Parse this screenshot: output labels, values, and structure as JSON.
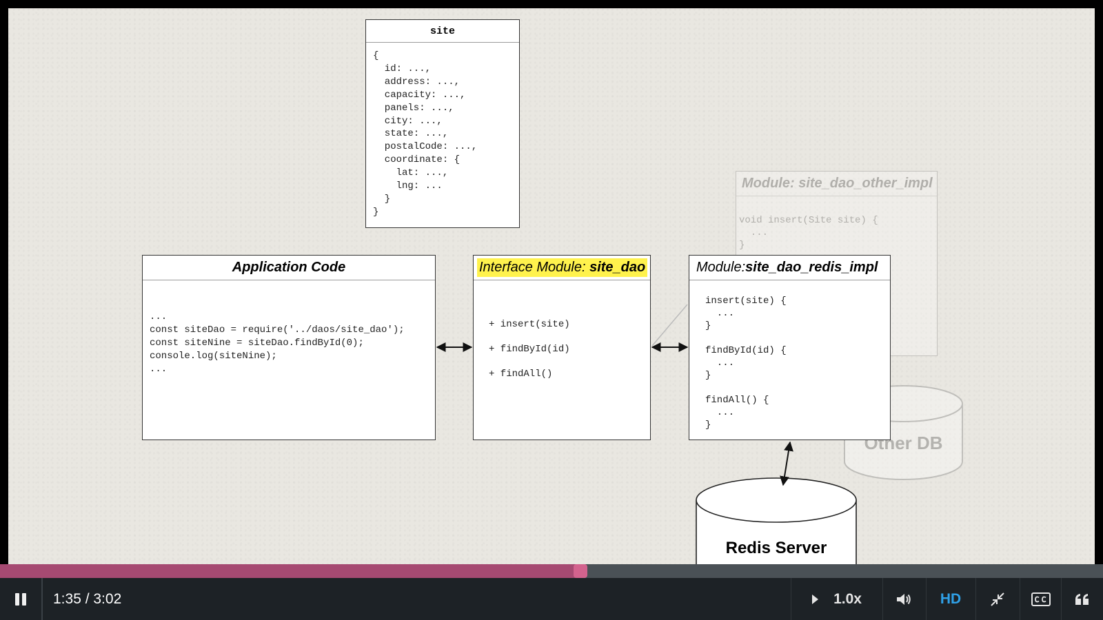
{
  "diagram": {
    "site": {
      "title": "site",
      "body": "{\n  id: ...,\n  address: ...,\n  capacity: ...,\n  panels: ...,\n  city: ...,\n  state: ...,\n  postalCode: ...,\n  coordinate: {\n    lat: ...,\n    lng: ...\n  }\n}"
    },
    "app_code": {
      "title": "Application Code",
      "body": "...\nconst siteDao = require('../daos/site_dao');\nconst siteNine = siteDao.findById(0);\nconsole.log(siteNine);\n..."
    },
    "interface": {
      "title_prefix": "Interface Module: ",
      "title_name": "site_dao",
      "methods": "+ insert(site)\n+ findById(id)\n+ findAll()"
    },
    "redis_impl": {
      "title_prefix": "Module: ",
      "title_name": "site_dao_redis_impl",
      "body": "insert(site) {\n  ...\n}\n\nfindById(id) {\n  ...\n}\n\nfindAll() {\n  ...\n}"
    },
    "other_impl": {
      "title": "Module: site_dao_other_impl",
      "body": "void insert(Site site) {\n  ...\n}"
    },
    "other_db": {
      "label": "Other DB"
    },
    "redis_server": {
      "label": "Redis Server"
    }
  },
  "player": {
    "time": "1:35 / 3:02",
    "progress_fraction": 0.526,
    "speed": "1.0x",
    "quality": "HD",
    "icons": {
      "play_pause": "pause-icon",
      "speed": "play-triangle-icon",
      "volume": "volume-icon",
      "exit_fullscreen": "exit-fullscreen-icon",
      "captions": "closed-captions-icon",
      "transcript": "quote-icon"
    },
    "colors": {
      "progress_fill": "#a64a72",
      "progress_knob": "#d3638e",
      "track": "#4a5156",
      "bar": "#1d2226",
      "hd": "#2fa1e8",
      "highlight": "#fff24d"
    }
  }
}
